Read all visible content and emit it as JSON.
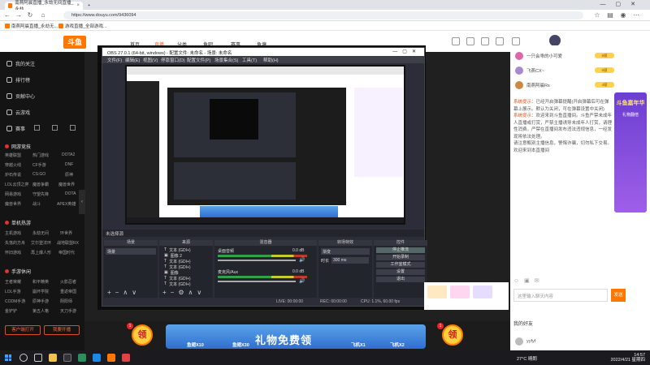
{
  "browser": {
    "tabs": [
      {
        "label": "南燕阿晨直播_永劫无间直播_永劫",
        "close": "×"
      },
      {
        "label": "+",
        "close": ""
      }
    ],
    "url": "https://www.douyu.com/9436094",
    "bookmarks": [
      "南燕阿晨直播_永劫无...",
      "游戏直播_全部游戏..."
    ]
  },
  "site": {
    "logo": "斗鱼",
    "nav": [
      "首页",
      "直播",
      "分类",
      "鱼吧",
      "赛事",
      "鱼塘"
    ]
  },
  "sidebar": {
    "items": [
      "我的关注",
      "排行榜",
      "贡献中心",
      "云游戏",
      "赛事"
    ],
    "sections": [
      {
        "title": "网游竞技",
        "subs": [
          "英雄联盟",
          "热门游戏",
          "DOTA2",
          "穿越火线",
          "CF手游",
          "DNF",
          "炉石传说",
          "CS:GO",
          "原神",
          "LOL云顶之弈",
          "魔兽争霸",
          "魔兽世界",
          "网易游戏",
          "守望先锋",
          "DOTA",
          "魔兽世界",
          "战斗",
          "APEX英雄"
        ]
      },
      {
        "title": "单机热游",
        "subs": [
          "主机游戏",
          "永劫无间",
          "环世界",
          "失落的方舟",
          "艾尔登法环",
          "战地联盟RX",
          "怀旧游戏",
          "再上爆人形",
          "帝国时代"
        ]
      },
      {
        "title": "手游休闲",
        "subs": [
          "王者荣耀",
          "和平精英",
          "火影忍者",
          "LOL手游",
          "崩坏学院",
          "重返帝国",
          "CODM手游",
          "原神手游",
          "阴阳师",
          "金铲铲",
          "第五人格",
          "天刀手游"
        ]
      }
    ],
    "btn_left": "客户端打开",
    "btn_right": "我要开播"
  },
  "obs": {
    "title": "OBS 27.0.1 (64-bit, windows) - 配置文件: 未命名 - 场景: 未命名",
    "menu": [
      "文件(F)",
      "编辑(E)",
      "视图(V)",
      "停靠窗口(D)",
      "配置文件(P)",
      "场景集合(S)",
      "工具(T)",
      "帮助(H)"
    ],
    "selbar": "未选择源",
    "docks": {
      "scenes": "场景",
      "sources": "来源",
      "mixer": "混音器",
      "transitions": "转场特效",
      "controls": "控件"
    },
    "scene": "场景",
    "sources": [
      "文本 (GDI+)",
      "图像 2",
      "文本 (GDI+)",
      "文本 (GDI+)",
      "图像",
      "文本 (GDI+)",
      "文本 (GDI+)"
    ],
    "mixer": [
      {
        "label": "桌面音频",
        "db": "0.0 dB"
      },
      {
        "label": "麦克风/Aux",
        "db": "0.0 dB"
      }
    ],
    "transition": {
      "name": "渐变",
      "duration_label": "时长",
      "duration": "300 ms"
    },
    "controls": [
      "停止推流",
      "开始录制",
      "工作室模式",
      "设置",
      "退出"
    ],
    "status": {
      "live": "LIVE: 00:00:00",
      "rec": "REC: 00:00:00",
      "cpu": "CPU: 1.1%, 60.00 fps"
    }
  },
  "right": {
    "ranks": [
      {
        "name": "一只会乖的小可爱",
        "badge": "6级"
      },
      {
        "name": "飞燕CX~",
        "badge": "6级"
      },
      {
        "name": "南燕阿晨Rs",
        "badge": "4级"
      }
    ],
    "chat": [
      {
        "tag": "系统提示：",
        "text": "已经开启弹幕提醒(开启弹幕后可在弹幕上展示。默认为关闭，可在弹幕设置中关闭)"
      },
      {
        "tag": "系统提示：",
        "text": "欢迎来到斗鱼直播间。斗鱼严禁未成年人直播或打赏，严禁主播诱导未成年人打赏，请理性消费。严禁在直播间发布违法违规信息，一经发现将依法处理。"
      },
      {
        "tag": "",
        "text": "请注意甄别主播信息，警惕诈骗，切勿私下交易。"
      },
      {
        "tag": "",
        "text": "欢迎来到本直播间"
      }
    ],
    "promo": {
      "title": "斗鱼嘉年华",
      "sub": "礼物翻倍"
    },
    "input_placeholder": "这里输入聊天内容",
    "send": "发送",
    "friend_title": "我的好友",
    "friend_name": "yyfyf"
  },
  "banner": {
    "ling": "领",
    "title": "礼物免费领",
    "items": [
      "鱼翅X10",
      "鱼翅X30",
      "飞机X1",
      "飞机X2"
    ],
    "count": "1"
  },
  "taskbar": {
    "weather": "27°C 晴朗",
    "time": "14:57",
    "date": "2022/4/21 星期四"
  }
}
